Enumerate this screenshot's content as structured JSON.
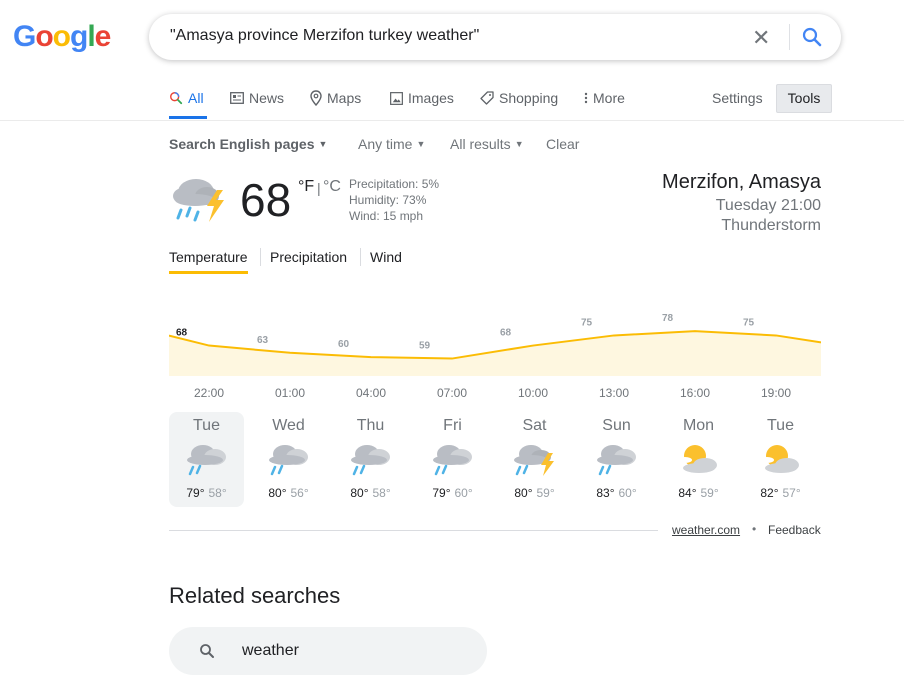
{
  "logo": {
    "letters": [
      "G",
      "o",
      "o",
      "g",
      "l",
      "e"
    ],
    "colors": [
      "#4285f4",
      "#ea4335",
      "#fbbc05",
      "#4285f4",
      "#34a853",
      "#ea4335"
    ]
  },
  "search": {
    "query": "\"Amasya province Merzifon turkey weather\""
  },
  "tabs": [
    {
      "label": "All",
      "icon": "search-icon"
    },
    {
      "label": "News",
      "icon": "news-icon"
    },
    {
      "label": "Maps",
      "icon": "map-pin-icon"
    },
    {
      "label": "Images",
      "icon": "image-icon"
    },
    {
      "label": "Shopping",
      "icon": "tag-icon"
    },
    {
      "label": "More",
      "icon": "more-dots-icon"
    }
  ],
  "settings_label": "Settings",
  "tools_label": "Tools",
  "filters": {
    "language": "Search English pages",
    "time": "Any time",
    "results": "All results",
    "clear": "Clear"
  },
  "weather": {
    "temperature": "68",
    "unit_f": "°F",
    "unit_sep": "|",
    "unit_c": "°C",
    "precipitation": "Precipitation: 5%",
    "humidity": "Humidity: 73%",
    "wind": "Wind: 15 mph",
    "location": "Merzifon, Amasya",
    "time": "Tuesday 21:00",
    "condition": "Thunderstorm",
    "tabs": [
      "Temperature",
      "Precipitation",
      "Wind"
    ]
  },
  "chart_data": {
    "type": "area",
    "x": [
      "22:00",
      "01:00",
      "04:00",
      "07:00",
      "10:00",
      "13:00",
      "16:00",
      "19:00"
    ],
    "values": [
      68,
      63,
      60,
      59,
      68,
      75,
      78,
      75
    ],
    "accent": "#fbbc04",
    "fill": "#fef7e0"
  },
  "forecast": [
    {
      "day": "Tue",
      "hi": "79°",
      "lo": "58°",
      "icon": "rain-cloud-icon"
    },
    {
      "day": "Wed",
      "hi": "80°",
      "lo": "56°",
      "icon": "rain-cloud-icon"
    },
    {
      "day": "Thu",
      "hi": "80°",
      "lo": "58°",
      "icon": "rain-cloud-icon"
    },
    {
      "day": "Fri",
      "hi": "79°",
      "lo": "60°",
      "icon": "rain-cloud-icon"
    },
    {
      "day": "Sat",
      "hi": "80°",
      "lo": "59°",
      "icon": "thunderstorm-icon"
    },
    {
      "day": "Sun",
      "hi": "83°",
      "lo": "60°",
      "icon": "rain-cloud-icon"
    },
    {
      "day": "Mon",
      "hi": "84°",
      "lo": "59°",
      "icon": "partly-sunny-icon"
    },
    {
      "day": "Tue",
      "hi": "82°",
      "lo": "57°",
      "icon": "partly-sunny-icon"
    }
  ],
  "source": "weather.com",
  "dot": "•",
  "feedback": "Feedback",
  "related": {
    "title": "Related searches",
    "items": [
      "weather"
    ]
  }
}
